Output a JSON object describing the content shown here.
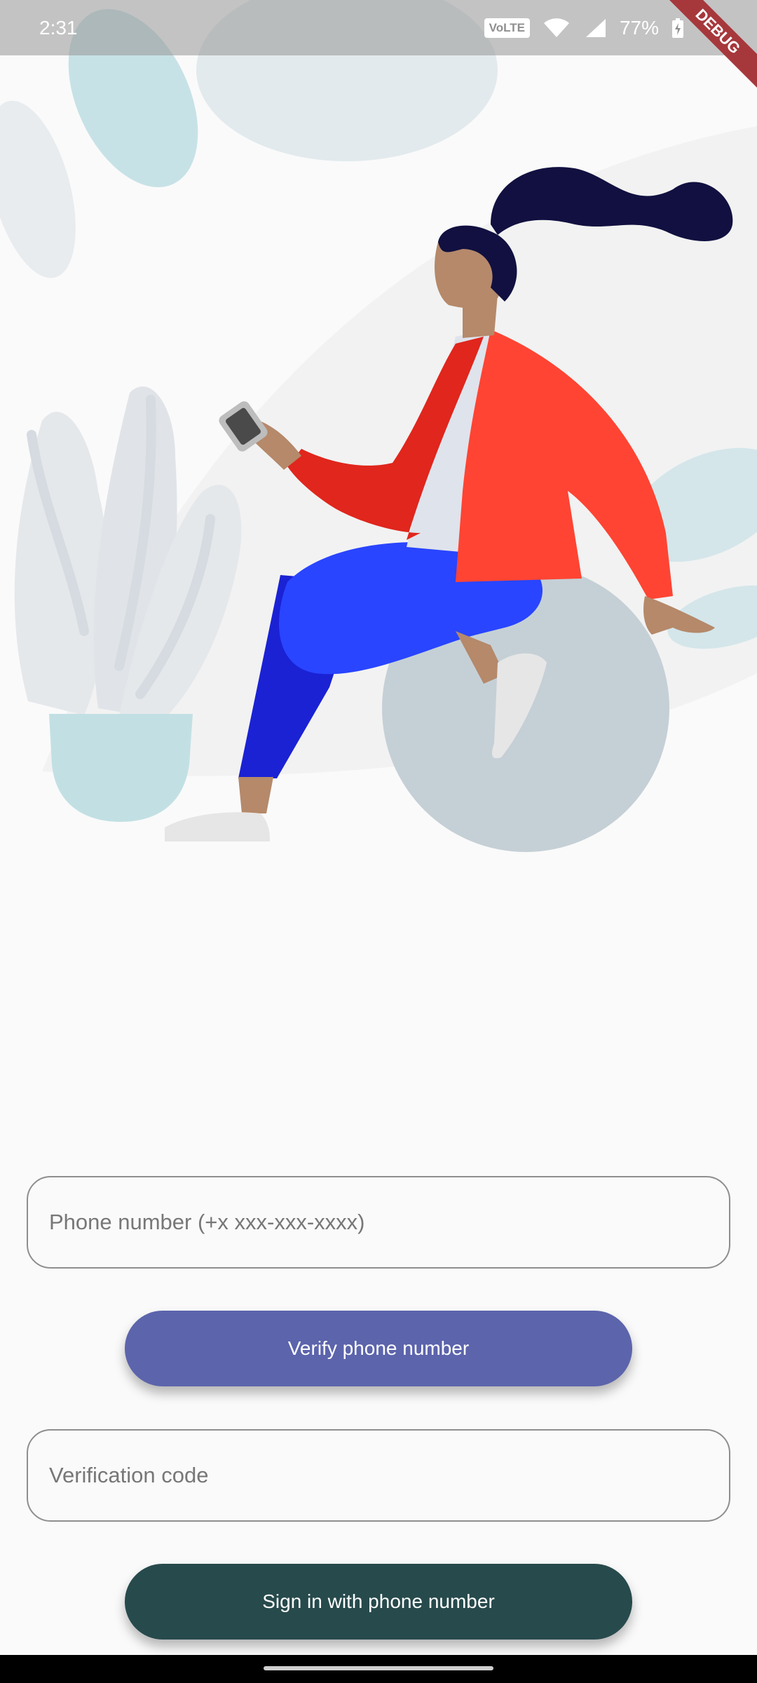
{
  "status_bar": {
    "time": "2:31",
    "network_badge": "VoLTE",
    "battery": "77%",
    "icons": [
      "wifi-icon",
      "signal-icon",
      "battery-charging-icon"
    ]
  },
  "debug_banner": "DEBUG",
  "form": {
    "phone_placeholder": "Phone number (+x xxx-xxx-xxxx)",
    "phone_value": "",
    "verify_label": "Verify phone number",
    "code_placeholder": "Verification code",
    "code_value": "",
    "signin_label": "Sign in with phone number"
  },
  "colors": {
    "verify_button": "#5c64ac",
    "signin_button": "#274a4c",
    "jacket": "#ff4433",
    "pants": "#2945ff",
    "ball": "#c5d0d6"
  }
}
